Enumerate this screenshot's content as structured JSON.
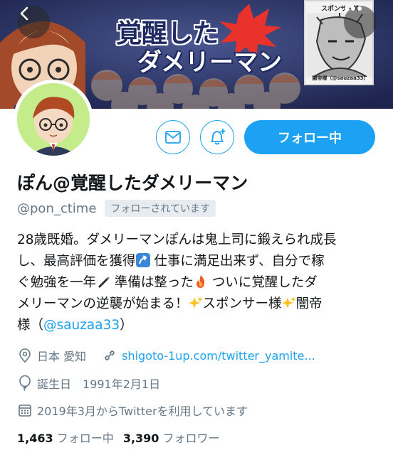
{
  "banner": {
    "title_line1": "覚醒した",
    "title_line2": "ダメリーマン",
    "sponsor_title": "スポンサー枠",
    "sponsor_caption": "闇帝様（@sauzaa33）"
  },
  "buttons": {
    "back_icon": "chevron-left-icon",
    "more_icon": "more-icon",
    "message_icon": "envelope-icon",
    "notify_icon": "bell-plus-icon",
    "follow_label": "フォロー中"
  },
  "profile": {
    "display_name": "ぽん@覚醒したダメリーマン",
    "handle": "@pon_ctime",
    "follows_you": "フォローされています"
  },
  "bio": {
    "line1": "28歳既婚。ダメリーマンぽんは鬼上司に鍛えられ成長",
    "line2a": "し、最高評価を獲得",
    "line2b": " 仕事に満足出来ず、自分で稼",
    "line3a": "ぐ勉強を一年",
    "line3b": " 準備は整った",
    "line3c": " ついに覚醒したダ",
    "line4a": "メリーマンの逆襲が始まる！",
    "line4b": "スポンサー様",
    "line4c": "闇帝",
    "line5a": "様（",
    "line5_link": "@sauzaa33",
    "line5b": "）"
  },
  "meta": {
    "location": "日本 愛知",
    "url": "shigoto-1up.com/twitter_yamite...",
    "birthday_label": "誕生日",
    "birthday": "1991年2月1日",
    "joined": "2019年3月からTwitterを利用しています"
  },
  "stats": {
    "following_count": "1,463",
    "following_label": "フォロー中",
    "followers_count": "3,390",
    "followers_label": "フォロワー"
  },
  "colors": {
    "accent": "#1da1f2",
    "secondary_text": "#657786",
    "primary_text": "#14171a",
    "avatar_bg": "#c5ec8b"
  }
}
